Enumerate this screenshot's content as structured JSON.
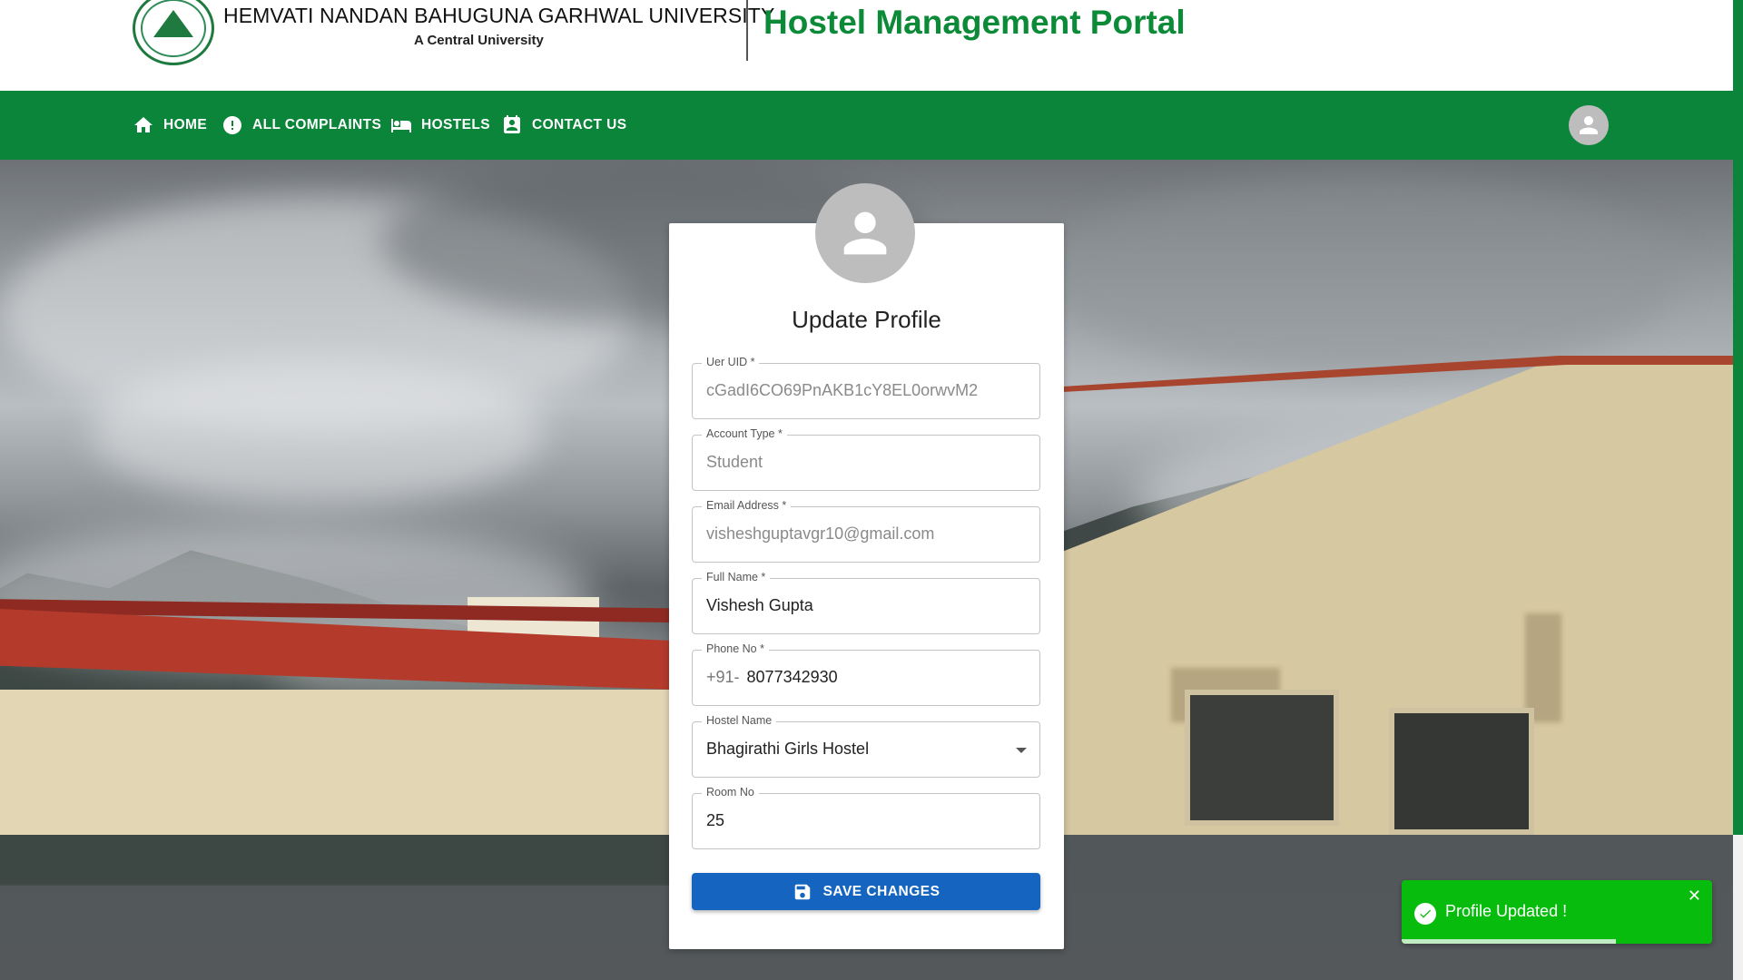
{
  "header": {
    "university_name": "HEMVATI NANDAN BAHUGUNA GARHWAL UNIVERSITY",
    "university_subtitle": "A Central University",
    "portal_title": "Hostel Management Portal"
  },
  "nav": {
    "items": [
      {
        "label": "HOME",
        "icon": "home-icon"
      },
      {
        "label": "ALL COMPLAINTS",
        "icon": "alert-circle-icon"
      },
      {
        "label": "HOSTELS",
        "icon": "bed-icon"
      },
      {
        "label": "CONTACT US",
        "icon": "contact-card-icon"
      }
    ],
    "profile_icon": "account-circle-icon"
  },
  "form": {
    "title": "Update Profile",
    "fields": {
      "uid": {
        "label": "Uer UID *",
        "value": "cGadI6CO69PnAKB1cY8EL0orwvM2",
        "disabled": true
      },
      "account_type": {
        "label": "Account Type *",
        "value": "Student",
        "disabled": true
      },
      "email": {
        "label": "Email Address *",
        "value": "visheshguptavgr10@gmail.com",
        "disabled": true
      },
      "full_name": {
        "label": "Full Name *",
        "value": "Vishesh Gupta"
      },
      "phone": {
        "label": "Phone No *",
        "prefix": "+91-",
        "value": "8077342930"
      },
      "hostel": {
        "label": "Hostel Name",
        "value": "Bhagirathi Girls Hostel"
      },
      "room": {
        "label": "Room No",
        "value": "25"
      }
    },
    "save_label": "SAVE CHANGES"
  },
  "toast": {
    "message": "Profile Updated !",
    "close_glyph": "✕",
    "status_color": "#07bc0c",
    "progress_remaining": 0.69
  },
  "colors": {
    "brand_green": "#0a8539",
    "title_green": "#0b8a38",
    "button_blue": "#1565c0"
  }
}
